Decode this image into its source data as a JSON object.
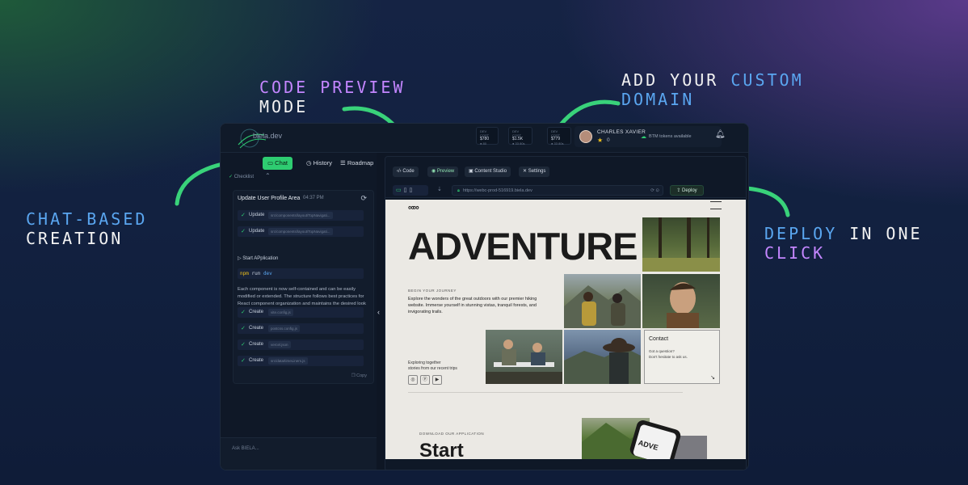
{
  "callouts": {
    "code_preview": {
      "line1": "CODE PREVIEW",
      "line2": "MODE"
    },
    "custom_domain": {
      "line1_a": "ADD YOUR ",
      "line1_b": "CUSTOM",
      "line2": "DOMAIN"
    },
    "chat_based": {
      "line1": "CHAT-BASED",
      "line2": "CREATION"
    },
    "deploy": {
      "line1_a": "DEPLOY",
      "line1_b": " IN ONE",
      "line2": "CLICK"
    }
  },
  "header": {
    "brand": "biela.dev",
    "stats": [
      {
        "label": "DEV COST",
        "value": "$780",
        "sub": "● 80"
      },
      {
        "label": "DEV COST",
        "value": "$1.5K",
        "sub": "● 33 80s"
      },
      {
        "label": "DEV COST",
        "value": "$779",
        "sub": "● 33 80s"
      }
    ],
    "user": {
      "name": "CHARLES XAVIER",
      "stars": "0",
      "tokens": "BTM tokens available"
    }
  },
  "left_panel": {
    "tabs": {
      "chat": "Chat",
      "history": "History",
      "roadmap": "Roadmap"
    },
    "checklist": "Checklist",
    "card": {
      "title": "Update User Profile Area",
      "time": "04:37 PM",
      "steps": [
        {
          "action": "Update",
          "path": "src/components/layout/TopNavigati..."
        },
        {
          "action": "Update",
          "path": "src/components/layout/TopNavigati..."
        }
      ],
      "start": "Start APplication",
      "npm": {
        "a": "npm",
        "b": "run",
        "c": "dev"
      },
      "paragraph": "Each component is now self-contained and can be easily modified or extended. The structure follows best practices for React component organization and maintains the desired look and feel while improving maintainability.",
      "creates": [
        {
          "action": "Create",
          "path": "vite.config.js"
        },
        {
          "action": "Create",
          "path": "postcss.config.js"
        },
        {
          "action": "Create",
          "path": "vercel.json"
        },
        {
          "action": "Create",
          "path": "src/data/timeLiners.js"
        }
      ],
      "copy": "Copy"
    },
    "ask_placeholder": "Ask BIELA..."
  },
  "right_panel": {
    "tabs": {
      "code": "Code",
      "preview": "Preview",
      "content": "Content Studio",
      "settings": "Settings"
    },
    "url": "https://webc-prod-516919.biela.dev",
    "deploy": "Deploy",
    "site": {
      "hero": "ADVENTURE",
      "begin": "BEGIN YOUR JOURNEY",
      "intro": "Explore the wonders of the great outdoors with our premier hiking website. Immerse yourself in stunning vistas, tranquil forests, and invigorating trails.",
      "explore_1": "Exploring together",
      "explore_2": "stories from our recent trips",
      "contact": {
        "title": "Contact",
        "q1": "Got a question?",
        "q2": "Don't hesitate to ask us."
      },
      "download": "DOWNLOAD OUR APPLICATION",
      "start": "Start",
      "phone_text": "ADVE"
    }
  }
}
